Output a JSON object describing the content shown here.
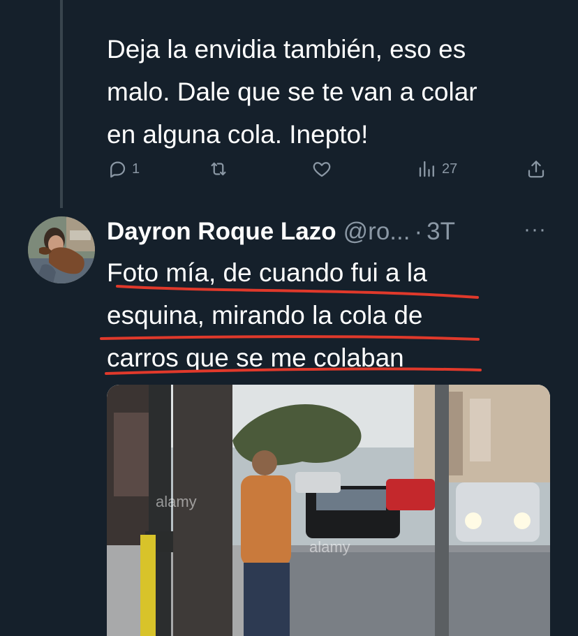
{
  "previous_tweet": {
    "lines": [
      "Deja la envidia también, eso es",
      "malo. Dale que se te van a colar",
      "en alguna cola. Inepto!"
    ],
    "reply_count": "1",
    "view_count": "27"
  },
  "reply": {
    "display_name": "Dayron Roque Lazo",
    "handle": "@ro...",
    "separator": "·",
    "time": "3T",
    "more": "···",
    "lines": [
      "Foto mía, de cuando fui a la",
      "esquina, mirando la cola de",
      "carros que se me colaban"
    ],
    "underline_color": "#e0392b"
  },
  "photo": {
    "watermark": "alamy"
  }
}
